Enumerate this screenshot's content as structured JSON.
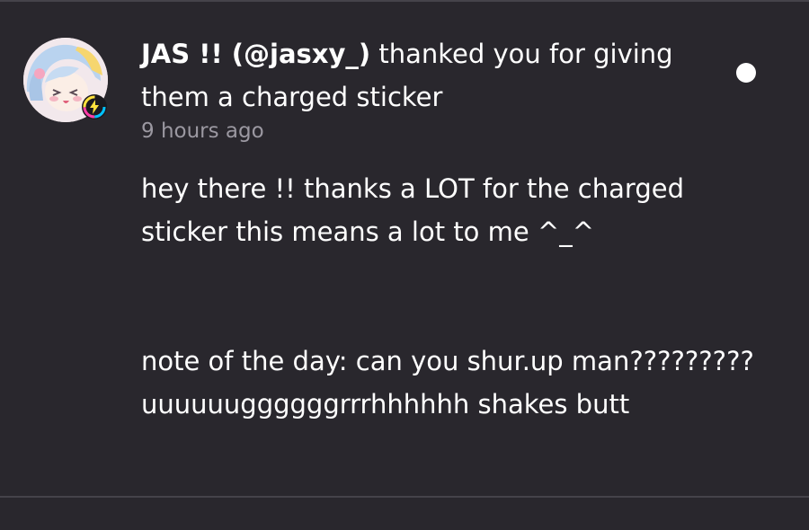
{
  "notification": {
    "user_name": "JAS !! (@jasxy_)",
    "action_text": " thanked you for giving them a charged sticker",
    "timestamp": "9 hours ago",
    "unread": true,
    "message_lines": [
      "hey there !! thanks a LOT for the charged sticker this means a lot to me ^_^",
      "note of the day: can you shur.up man????????? uuuuuuggggggrrrhhhhhh shakes butt"
    ],
    "avatar_icon": "user-avatar-anime",
    "badge_icon": "lightning-bolt-badge-icon"
  },
  "colors": {
    "background": "#29272d",
    "text": "#ffffff",
    "muted": "#9b98a1",
    "divider": "#45434a"
  }
}
